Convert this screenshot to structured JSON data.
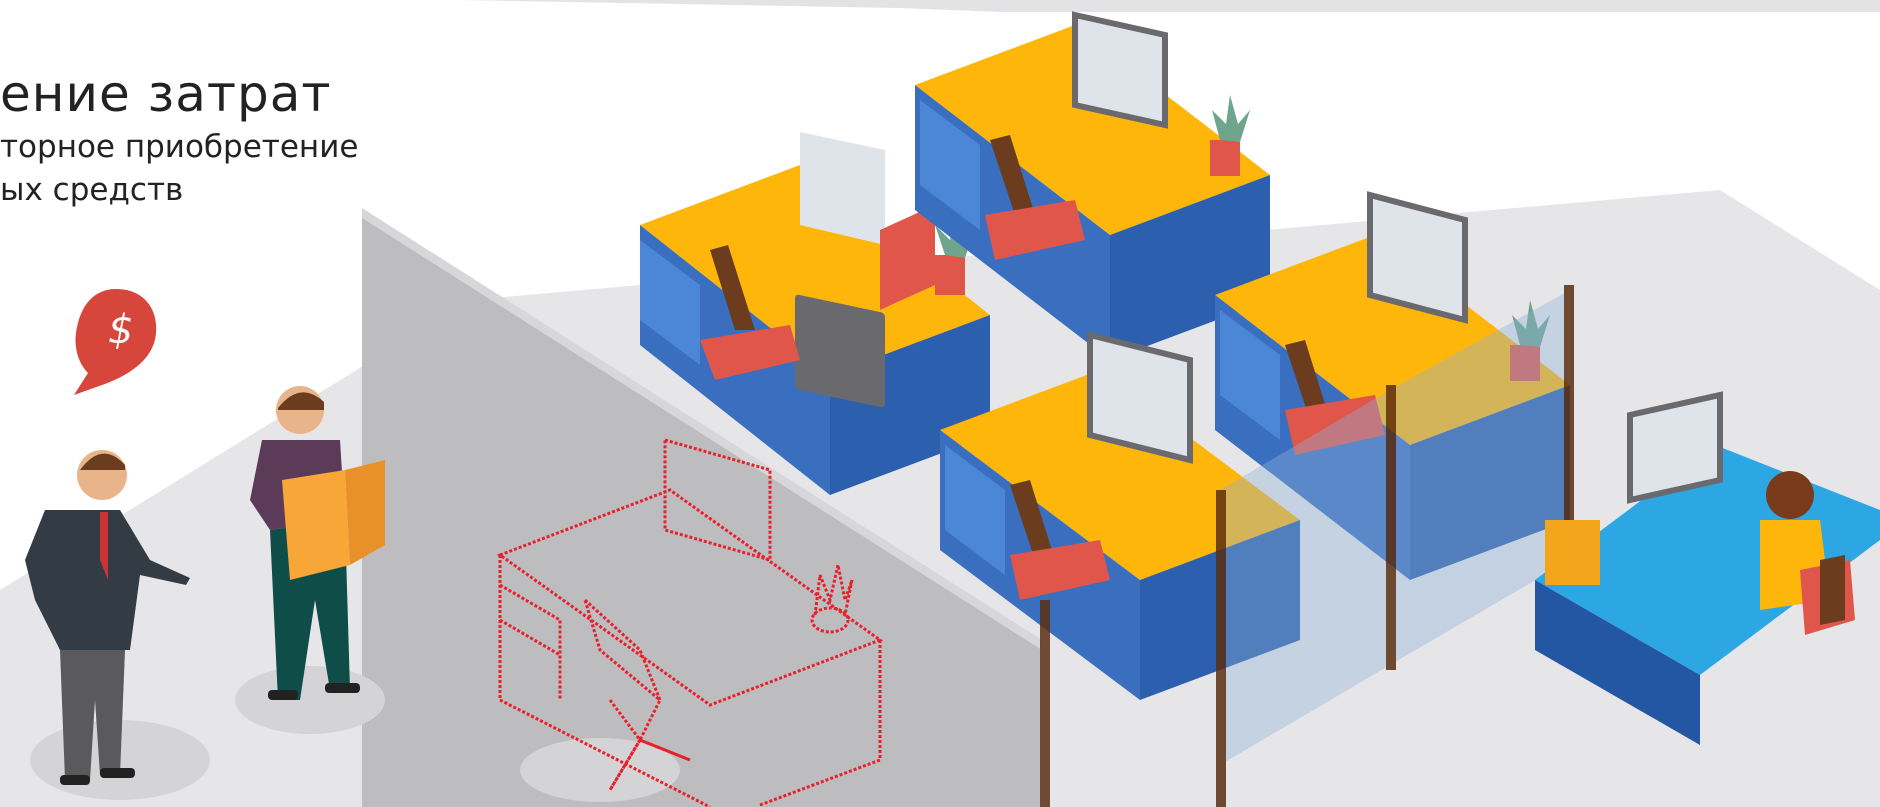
{
  "caption": {
    "title": "ение затрат",
    "line1": "торное приобретение",
    "line2": "ых средств"
  },
  "badge": {
    "symbol": "$",
    "color": "#d6463b"
  },
  "colors": {
    "desk_top": "#ffb60b",
    "desk_side": "#2c5fad",
    "drawers": "#3c72c2",
    "chair_seat": "#e0564a",
    "chair_back": "#6b3d1e",
    "glass": "#8fb2d8",
    "outline_desk": "#e8202a",
    "worker_desk": "#2ca7e4"
  }
}
